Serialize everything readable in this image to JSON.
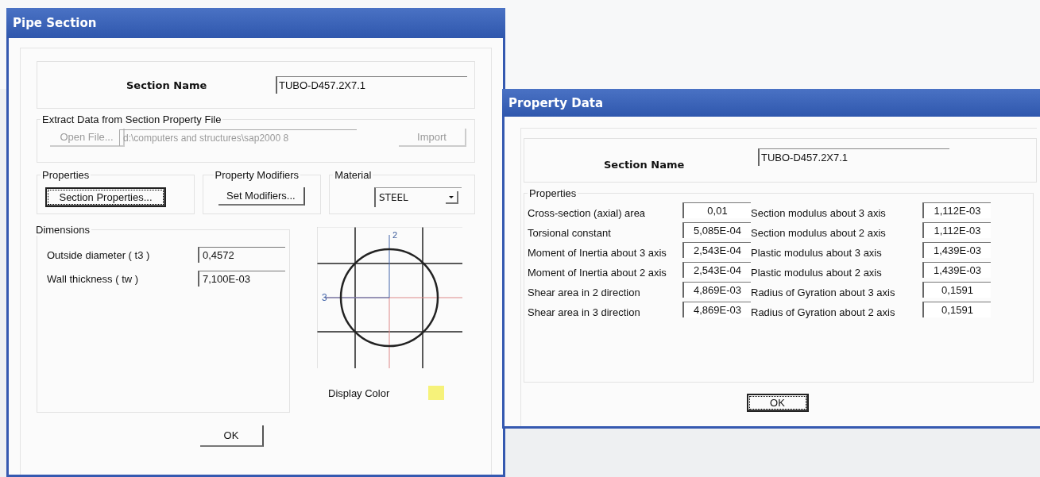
{
  "pipe_section": {
    "title": "Pipe Section",
    "section_name": {
      "label": "Section Name",
      "value": "TUBO-D457.2X7.1"
    },
    "extract": {
      "legend": "Extract Data from Section Property File",
      "open_button": {
        "label": "Open File...",
        "disabled": true
      },
      "path": {
        "value": "d:\\computers and structures\\sap2000 8",
        "disabled": true
      },
      "import_button": {
        "label": "Import",
        "disabled": true
      }
    },
    "properties": {
      "legend": "Properties",
      "button": {
        "label": "Section Properties...",
        "focused": true
      }
    },
    "modifiers": {
      "legend": "Property Modifiers",
      "button": {
        "label": "Set Modifiers...",
        "focused": false
      }
    },
    "material": {
      "legend": "Material",
      "value": "STEEL"
    },
    "dimensions": {
      "legend": "Dimensions",
      "fields": [
        {
          "label": "Outside diameter  ( t3 )",
          "value": "0,4572"
        },
        {
          "label": "Wall thickness  ( tw )",
          "value": "7,100E-03"
        }
      ]
    },
    "preview": {
      "axis_vertical": "2",
      "axis_horizontal": "3"
    },
    "display_color": {
      "label": "Display Color",
      "color": "#f6f27a"
    },
    "ok_button": {
      "label": "OK",
      "focused": false
    }
  },
  "property_data": {
    "title": "Property Data",
    "section_name": {
      "label": "Section Name",
      "value": "TUBO-D457.2X7.1"
    },
    "properties": {
      "legend": "Properties",
      "rows": [
        {
          "label": "Cross-section (axial) area",
          "value": "0,01"
        },
        {
          "label": "Section modulus about 3 axis",
          "value": "1,112E-03"
        },
        {
          "label": "Torsional constant",
          "value": "5,085E-04"
        },
        {
          "label": "Section modulus about 2 axis",
          "value": "1,112E-03"
        },
        {
          "label": "Moment of Inertia about 3 axis",
          "value": "2,543E-04"
        },
        {
          "label": "Plastic modulus about 3 axis",
          "value": "1,439E-03"
        },
        {
          "label": "Moment of Inertia about 2 axis",
          "value": "2,543E-04"
        },
        {
          "label": "Plastic modulus about 2 axis",
          "value": "1,439E-03"
        },
        {
          "label": "Shear area in 2 direction",
          "value": "4,869E-03"
        },
        {
          "label": "Radius of Gyration about 3 axis",
          "value": "0,1591"
        },
        {
          "label": "Shear area in 3 direction",
          "value": "4,869E-03"
        },
        {
          "label": "Radius of Gyration about 2 axis",
          "value": "0,1591"
        }
      ]
    },
    "ok_button": {
      "label": "OK",
      "focused": true
    }
  }
}
